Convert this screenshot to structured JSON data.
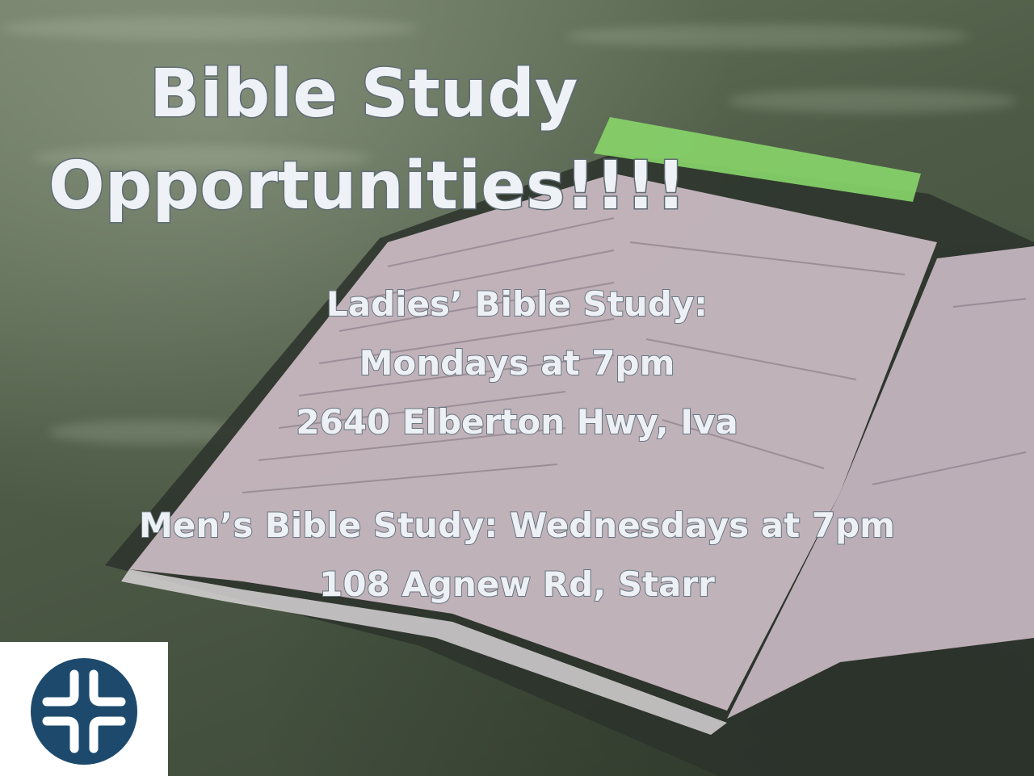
{
  "title": {
    "line1": "Bible Study",
    "line2": "Opportunities!!!!"
  },
  "ladies": {
    "heading": "Ladies’ Bible Study:",
    "time": "Mondays at 7pm",
    "address": "2640 Elberton Hwy, Iva"
  },
  "men": {
    "heading_time": "Men’s Bible Study: Wednesdays at 7pm",
    "address": "108 Agnew Rd, Starr"
  },
  "colors": {
    "text": "#edf0f4",
    "outline": "#667580",
    "logo": "#1d4a6c"
  },
  "logo": {
    "icon": "cross-logo-icon"
  }
}
